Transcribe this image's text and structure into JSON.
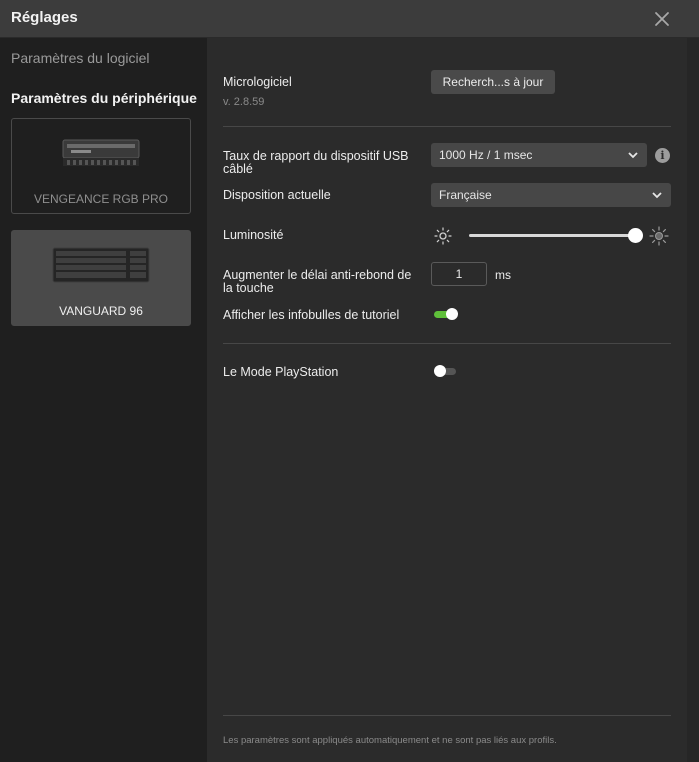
{
  "window": {
    "title": "Réglages"
  },
  "sidebar": {
    "software_label": "Paramètres du logiciel",
    "device_label": "Paramètres du périphérique",
    "devices": [
      {
        "name": "VENGEANCE RGB PRO",
        "icon": "ram-module-icon",
        "selected": false
      },
      {
        "name": "VANGUARD 96",
        "icon": "keyboard-icon",
        "selected": true
      }
    ]
  },
  "firmware": {
    "label": "Micrologiciel",
    "version": "v. 2.8.59",
    "button": "Recherch...s à jour"
  },
  "usb_rate": {
    "label": "Taux de rapport du dispositif USB câblé",
    "value": "1000 Hz / 1 msec",
    "info_glyph": "i"
  },
  "layout": {
    "label": "Disposition actuelle",
    "value": "Française"
  },
  "brightness": {
    "label": "Luminosité",
    "level": 1.0
  },
  "debounce": {
    "label": "Augmenter le délai anti-rebond de la touche",
    "value": "1",
    "unit": "ms"
  },
  "tooltips": {
    "label": "Afficher les infobulles de tutoriel",
    "enabled": true
  },
  "playstation": {
    "label": "Le Mode PlayStation",
    "enabled": false
  },
  "footer": {
    "note": "Les paramètres sont appliqués automatiquement et ne sont pas liés aux profils."
  },
  "colors": {
    "accent_on": "#5fbf3a",
    "background": "#2b2b2b",
    "sidebar": "#1f1f1f"
  }
}
